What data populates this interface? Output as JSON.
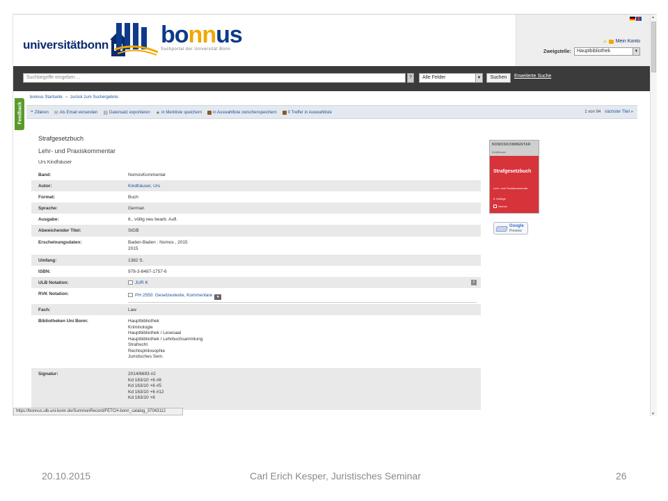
{
  "header": {
    "university_wordmark": "universitätbonn",
    "portal_name": "bonnus",
    "portal_name_a": "bo",
    "portal_name_b": "nn",
    "portal_name_c": "us",
    "portal_tagline": "Suchportal der Universität Bonn",
    "my_account": "Mein Konto",
    "branch_label": "Zweigstelle:",
    "branch_value": "Hauptbibliothek",
    "colors": {
      "brand_blue": "#0d3a8a",
      "brand_orange": "#f0a800"
    }
  },
  "search": {
    "placeholder": "Suchbegriffe eingeben ...",
    "help": "?",
    "field_select": "Alle Felder",
    "submit": "Suchen",
    "advanced": "Erweiterte Suche"
  },
  "breadcrumb": {
    "home": "bonnus Startseite",
    "back": "zurück zum Suchergebnis"
  },
  "feedback": "Feedback",
  "toolbar": {
    "cite": "Zitieren",
    "email": "Als Email versenden",
    "export": "Datensatz exportieren",
    "watchlist": "in Merkliste speichern",
    "selection": "in Auswahlliste zwischenspeichern",
    "hits": "0 Treffer in Auswahlliste",
    "position": "1 von 94",
    "next": "nächster Titel"
  },
  "record": {
    "title": "Strafgesetzbuch",
    "subtitle": "Lehr- und Praxiskommentar",
    "author": "Urs Kindhäuser",
    "fields": [
      {
        "label": "Band:",
        "value": "NomosKommentar"
      },
      {
        "label": "Autor:",
        "value": "Kindhäuser, Urs"
      },
      {
        "label": "Format:",
        "value": "Buch"
      },
      {
        "label": "Sprache:",
        "value": "German"
      },
      {
        "label": "Ausgabe:",
        "value": "6., völlig neu bearb. Aufl."
      },
      {
        "label": "Abweichender Titel:",
        "value": "StGB"
      },
      {
        "label": "Erscheinungsdaten:",
        "line1": "Baden-Baden : Nomos , 2015",
        "line2": "2015"
      },
      {
        "label": "Umfang:",
        "value": "1382 S."
      },
      {
        "label": "ISBN:",
        "value": "978-3-8487-1757-6"
      },
      {
        "label": "ULB Notation:",
        "value": "JUR K"
      },
      {
        "label": "RVK Notation:",
        "value": "PH 2550: Gesetzestexte, Kommentare"
      },
      {
        "label": "Fach:",
        "value": "Law"
      },
      {
        "label": "Bibliotheken Uni Bonn:",
        "lines": [
          "Hauptbibliothek",
          "Kriminologie",
          "Hauptbibliothek / Lesesaal",
          "Hauptbibliothek / Lehrbuchsammlung",
          "Strafrecht",
          "Rechtsphilosophie",
          "Juristisches Sem."
        ]
      },
      {
        "label": "Signatur:",
        "lines": [
          "2014/6693 #2",
          "Kd 163/10 +6 #8",
          "Kd 163/10 +6 #5",
          "Kd 163/10 +6 #12",
          "Kd 163/10 +6"
        ]
      }
    ]
  },
  "cover": {
    "series": "NOMOSKOMMENTAR",
    "author": "Kindhäuser",
    "title": "Strafgesetzbuch",
    "subtitle": "Lehr- und Praxiskommentar",
    "edition": "6. Auflage",
    "publisher": "Nomos"
  },
  "google_preview": {
    "line1": "Google",
    "line2": "Preview"
  },
  "status_url": "https://bonnus.ulb.uni-bonn.de/SummonRecord/FETCH-bonn_catalog_37043112",
  "footer": {
    "date": "20.10.2015",
    "center": "Carl Erich Kesper, Juristisches Seminar",
    "page": "26"
  }
}
